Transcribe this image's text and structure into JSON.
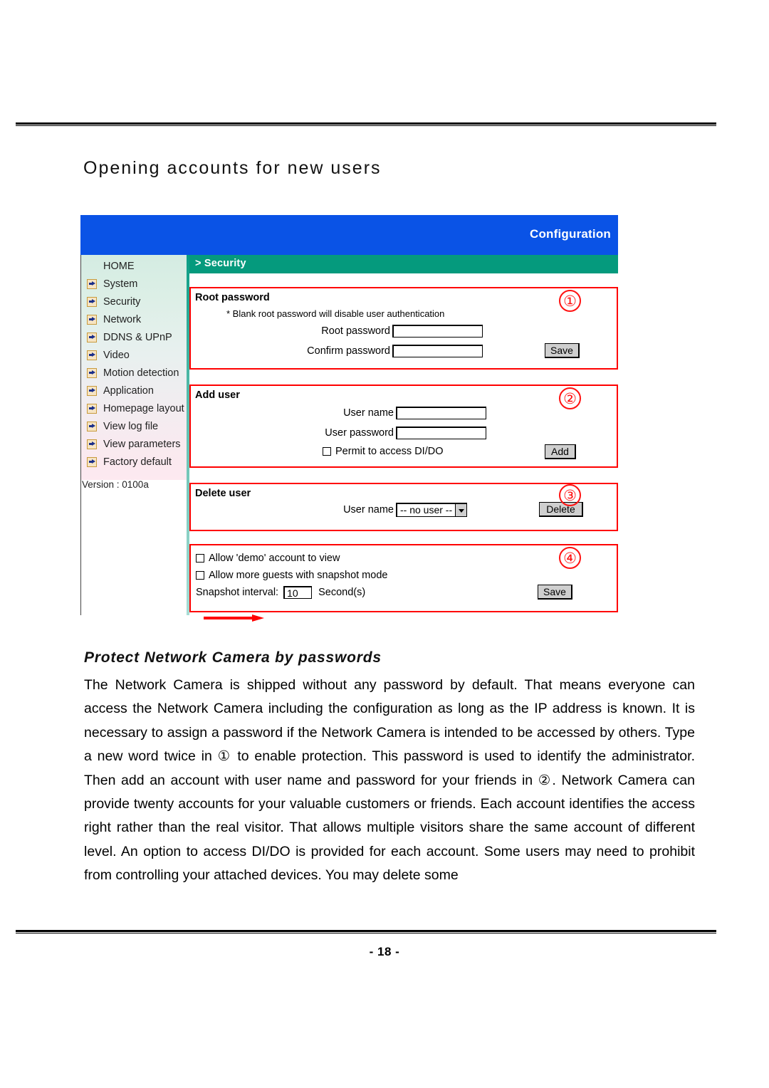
{
  "page": {
    "title": "Opening accounts for new users",
    "number": "- 18 -",
    "subtitle": "Protect Network Camera by passwords",
    "paragraph": "The Network Camera is shipped without any password by default. That means everyone can access the Network Camera including the configuration as long as the IP address is known. It is necessary to assign a password if the Network Camera is intended to be accessed by others. Type a new word twice in ① to enable protection. This password is used to identify the administrator. Then add an account with user name and password for your friends in ②. Network Camera can provide twenty accounts for your valuable customers or friends. Each account identifies the access right rather than the real visitor. That allows multiple visitors share the same account of different level.   An option to access DI/DO is provided for each account. Some users may need to prohibit from controlling your attached devices. You may delete some"
  },
  "screenshot": {
    "header": {
      "title": "Configuration",
      "breadcrumb": "> Security"
    },
    "sidebar": {
      "items": [
        {
          "label": "HOME",
          "icon": null
        },
        {
          "label": "System",
          "icon": "arrow-icon"
        },
        {
          "label": "Security",
          "icon": "arrow-icon"
        },
        {
          "label": "Network",
          "icon": "arrow-icon"
        },
        {
          "label": "DDNS & UPnP",
          "icon": "arrow-icon"
        },
        {
          "label": "Video",
          "icon": "arrow-icon"
        },
        {
          "label": "Motion detection",
          "icon": "arrow-icon"
        },
        {
          "label": "Application",
          "icon": "arrow-icon"
        },
        {
          "label": "Homepage layout",
          "icon": "arrow-icon"
        },
        {
          "label": "View log file",
          "icon": "arrow-icon"
        },
        {
          "label": "View parameters",
          "icon": "arrow-icon"
        },
        {
          "label": "Factory default",
          "icon": "arrow-icon"
        }
      ],
      "version": "Version : 0100a"
    },
    "root_password": {
      "title": "Root password",
      "hint": "* Blank root password will disable user authentication",
      "root_label": "Root password",
      "root_value": "",
      "confirm_label": "Confirm password",
      "confirm_value": "",
      "save_label": "Save",
      "step": "①"
    },
    "add_user": {
      "title": "Add user",
      "name_label": "User name",
      "name_value": "",
      "password_label": "User password",
      "password_value": "",
      "permit_label": "Permit to access DI/DO",
      "permit_checked": false,
      "add_label": "Add",
      "step": "②"
    },
    "delete_user": {
      "title": "Delete user",
      "name_label": "User name",
      "selected": "-- no user --",
      "options": [
        "-- no user --"
      ],
      "delete_label": "Delete",
      "step": "③"
    },
    "options": {
      "demo_label": "Allow 'demo' account to view",
      "demo_checked": false,
      "guests_label": "Allow more guests with snapshot mode",
      "guests_checked": false,
      "interval_label": "Snapshot interval:",
      "interval_value": "10",
      "interval_unit": "Second(s)",
      "save_label": "Save",
      "step": "④"
    }
  },
  "colors": {
    "header_blue": "#0a53e6",
    "bar_green": "#059a7d",
    "annotation_red": "#ff0000"
  }
}
